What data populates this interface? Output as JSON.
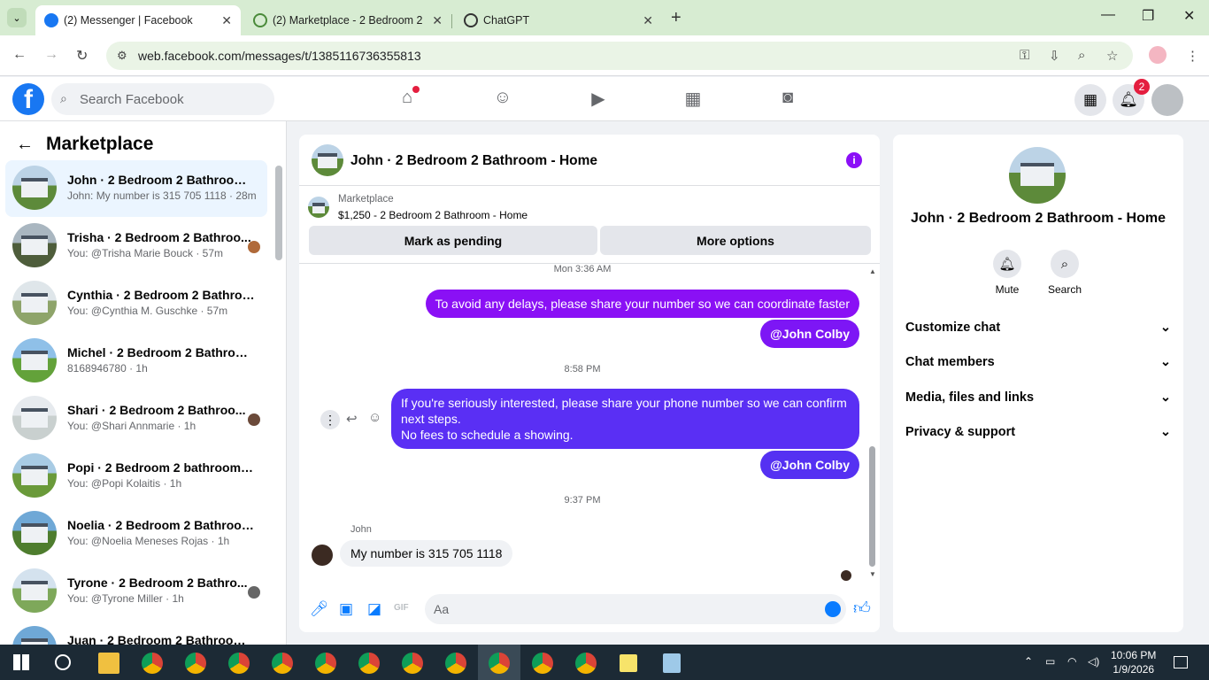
{
  "browser": {
    "tabs": [
      {
        "label": "(2) Messenger | Facebook",
        "active": true
      },
      {
        "label": "(2) Marketplace - 2 Bedroom 2",
        "active": false
      },
      {
        "label": "ChatGPT",
        "active": false
      }
    ],
    "url": "web.facebook.com/messages/t/1385116736355813"
  },
  "facebook": {
    "search_placeholder": "Search Facebook",
    "notifications_count": "2"
  },
  "sidebar": {
    "title": "Marketplace",
    "conversations": [
      {
        "title": "John · 2 Bedroom 2 Bathroom - ...",
        "preview": "John: My number is 315 705 1118 · 28m",
        "selected": true
      },
      {
        "title": "Trisha · 2 Bedroom 2 Bathroo...",
        "preview": "You: @Trisha Marie Bouck · 57m"
      },
      {
        "title": "Cynthia · 2 Bedroom 2 Bathroo...",
        "preview": "You: @Cynthia M. Guschke · 57m"
      },
      {
        "title": "Michel · 2 Bedroom 2 Bathroom...",
        "preview": "8168946780 · 1h"
      },
      {
        "title": "Shari · 2 Bedroom 2 Bathroo...",
        "preview": "You: @Shari Annmarie · 1h"
      },
      {
        "title": "Popi · 2 Bedroom 2 bathroom h...",
        "preview": "You: @Popi Kolaitis · 1h"
      },
      {
        "title": "Noelia · 2 Bedroom 2 Bathroom...",
        "preview": "You: @Noelia Meneses Rojas · 1h"
      },
      {
        "title": "Tyrone · 2 Bedroom 2 Bathro...",
        "preview": "You: @Tyrone Miller · 1h"
      },
      {
        "title": "Juan · 2 Bedroom 2 Bathroom - ...",
        "preview": ""
      }
    ]
  },
  "chat": {
    "title": "John · 2 Bedroom 2 Bathroom - Home",
    "listing_source": "Marketplace",
    "listing": "$1,250 - 2 Bedroom 2 Bathroom - Home",
    "mark_pending": "Mark as pending",
    "more_options": "More options",
    "time1": "Mon 3:36 AM",
    "msg1": "To avoid any delays, please share your number so we can coordinate faster",
    "mention1": "@John Colby",
    "time2": "8:58 PM",
    "msg2_line1": "If you're seriously interested, please share your phone number so we can confirm",
    "msg2_line2": "next steps.",
    "msg2_line3": "No fees to schedule a showing.",
    "mention2": "@John Colby",
    "time3": "9:37 PM",
    "sender": "John",
    "reply": "My number is 315 705 1118",
    "composer_placeholder": "Aa",
    "gif": "GIF"
  },
  "details": {
    "name": "John · 2 Bedroom 2 Bathroom - Home",
    "mute": "Mute",
    "search": "Search",
    "sections": [
      "Customize chat",
      "Chat members",
      "Media, files and links",
      "Privacy & support"
    ]
  },
  "taskbar": {
    "time": "10:06 PM",
    "date": "1/9/2026"
  },
  "colors": {
    "accent": "#8b0ff7",
    "bubble_purple": "#8a10f5",
    "bubble_indigo": "#5a2ff4",
    "messenger_blue": "#0a7cff"
  }
}
